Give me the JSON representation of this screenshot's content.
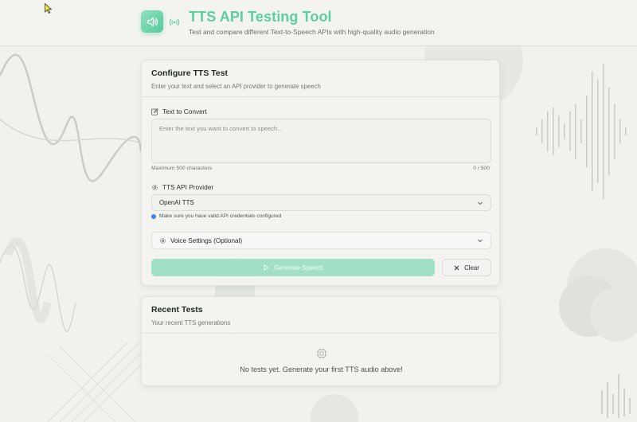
{
  "header": {
    "title": "TTS API Testing Tool",
    "subtitle": "Test and compare different Text-to-Speech APIs with high-quality audio generation",
    "logo_icon": "speaker-icon",
    "status_icon": "broadcast-icon"
  },
  "config_card": {
    "title": "Configure TTS Test",
    "description": "Enter your text and select an API provider to generate speech",
    "text_field": {
      "label": "Text to Convert",
      "placeholder": "Enter the text you want to convert to speech...",
      "value": "",
      "max_hint": "Maximum 500 characters",
      "counter": "0 / 500"
    },
    "provider": {
      "label": "TTS API Provider",
      "selected": "OpenAI TTS",
      "note": "Make sure you have valid API credentials configured"
    },
    "voice_settings": {
      "label": "Voice Settings (Optional)"
    },
    "buttons": {
      "generate": "Generate Speech",
      "clear": "Clear"
    }
  },
  "recent_card": {
    "title": "Recent Tests",
    "description": "Your recent TTS generations",
    "empty_message": "No tests yet. Generate your first TTS audio above!"
  },
  "colors": {
    "accent": "#5ccf9e",
    "button_disabled": "#a2e1c5",
    "info_dot": "#3b82f6",
    "background": "#f1f2ee"
  }
}
